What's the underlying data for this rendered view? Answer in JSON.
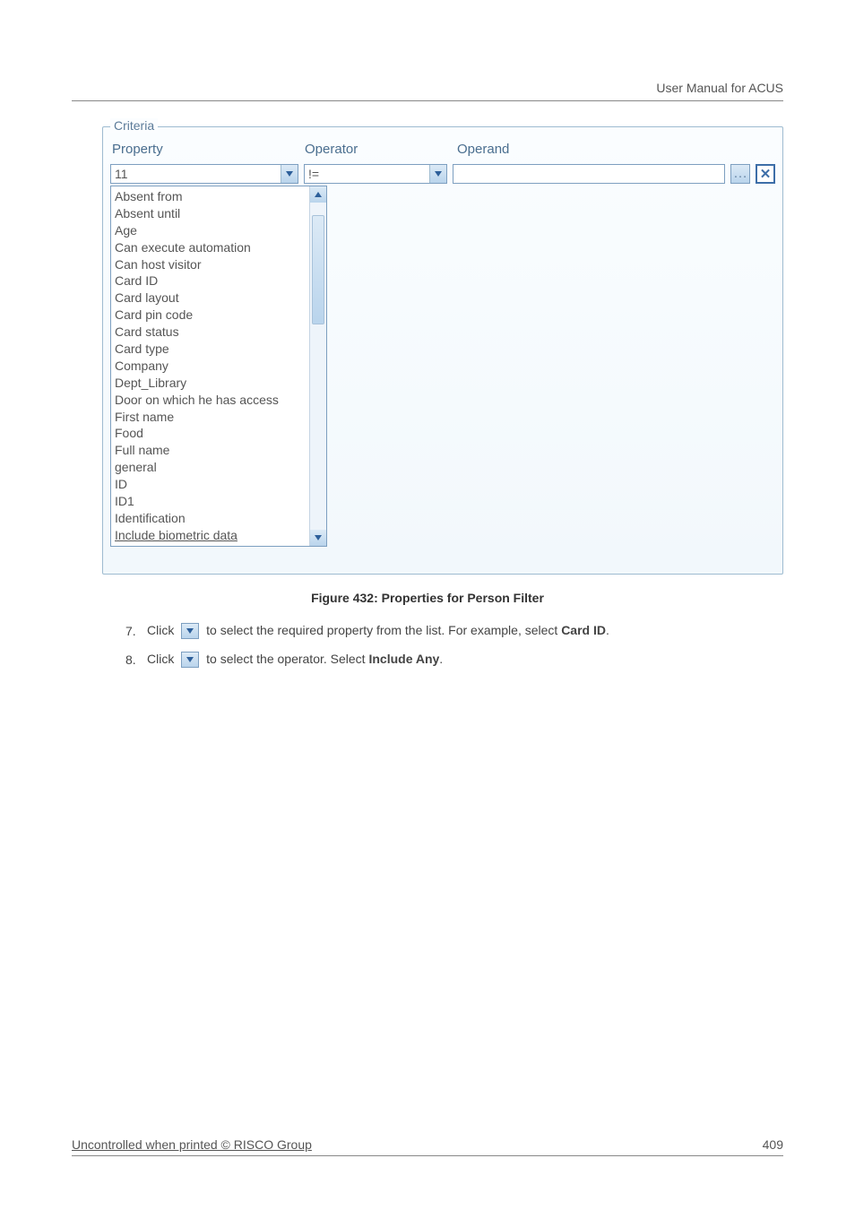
{
  "header": {
    "title": "User Manual for ACUS"
  },
  "criteria": {
    "legend": "Criteria",
    "columns": {
      "property": "Property",
      "operator": "Operator",
      "operand": "Operand"
    },
    "property_value": "11",
    "operator_value": "!=",
    "operand_value": "",
    "property_options": [
      "Absent from",
      "Absent until",
      "Age",
      "Can execute automation",
      "Can host visitor",
      "Card ID",
      "Card layout",
      "Card pin code",
      "Card status",
      "Card type",
      "Company",
      "Dept_Library",
      "Door on which he has access",
      "First name",
      "Food",
      "Full name",
      "general",
      "ID",
      "ID1",
      "Identification",
      "Include biometric data"
    ]
  },
  "caption": "Figure 432: Properties for Person Filter",
  "steps": {
    "s7": {
      "num": "7.",
      "pre": "Click ",
      "post_a": " to select the required property from the list. For example, select ",
      "bold": "Card ID",
      "tail": "."
    },
    "s8": {
      "num": "8.",
      "pre": "Click ",
      "post_a": " to select the operator. Select ",
      "bold": "Include Any",
      "tail": "."
    }
  },
  "footer": {
    "left": "Uncontrolled when printed © RISCO Group",
    "right": "409"
  }
}
